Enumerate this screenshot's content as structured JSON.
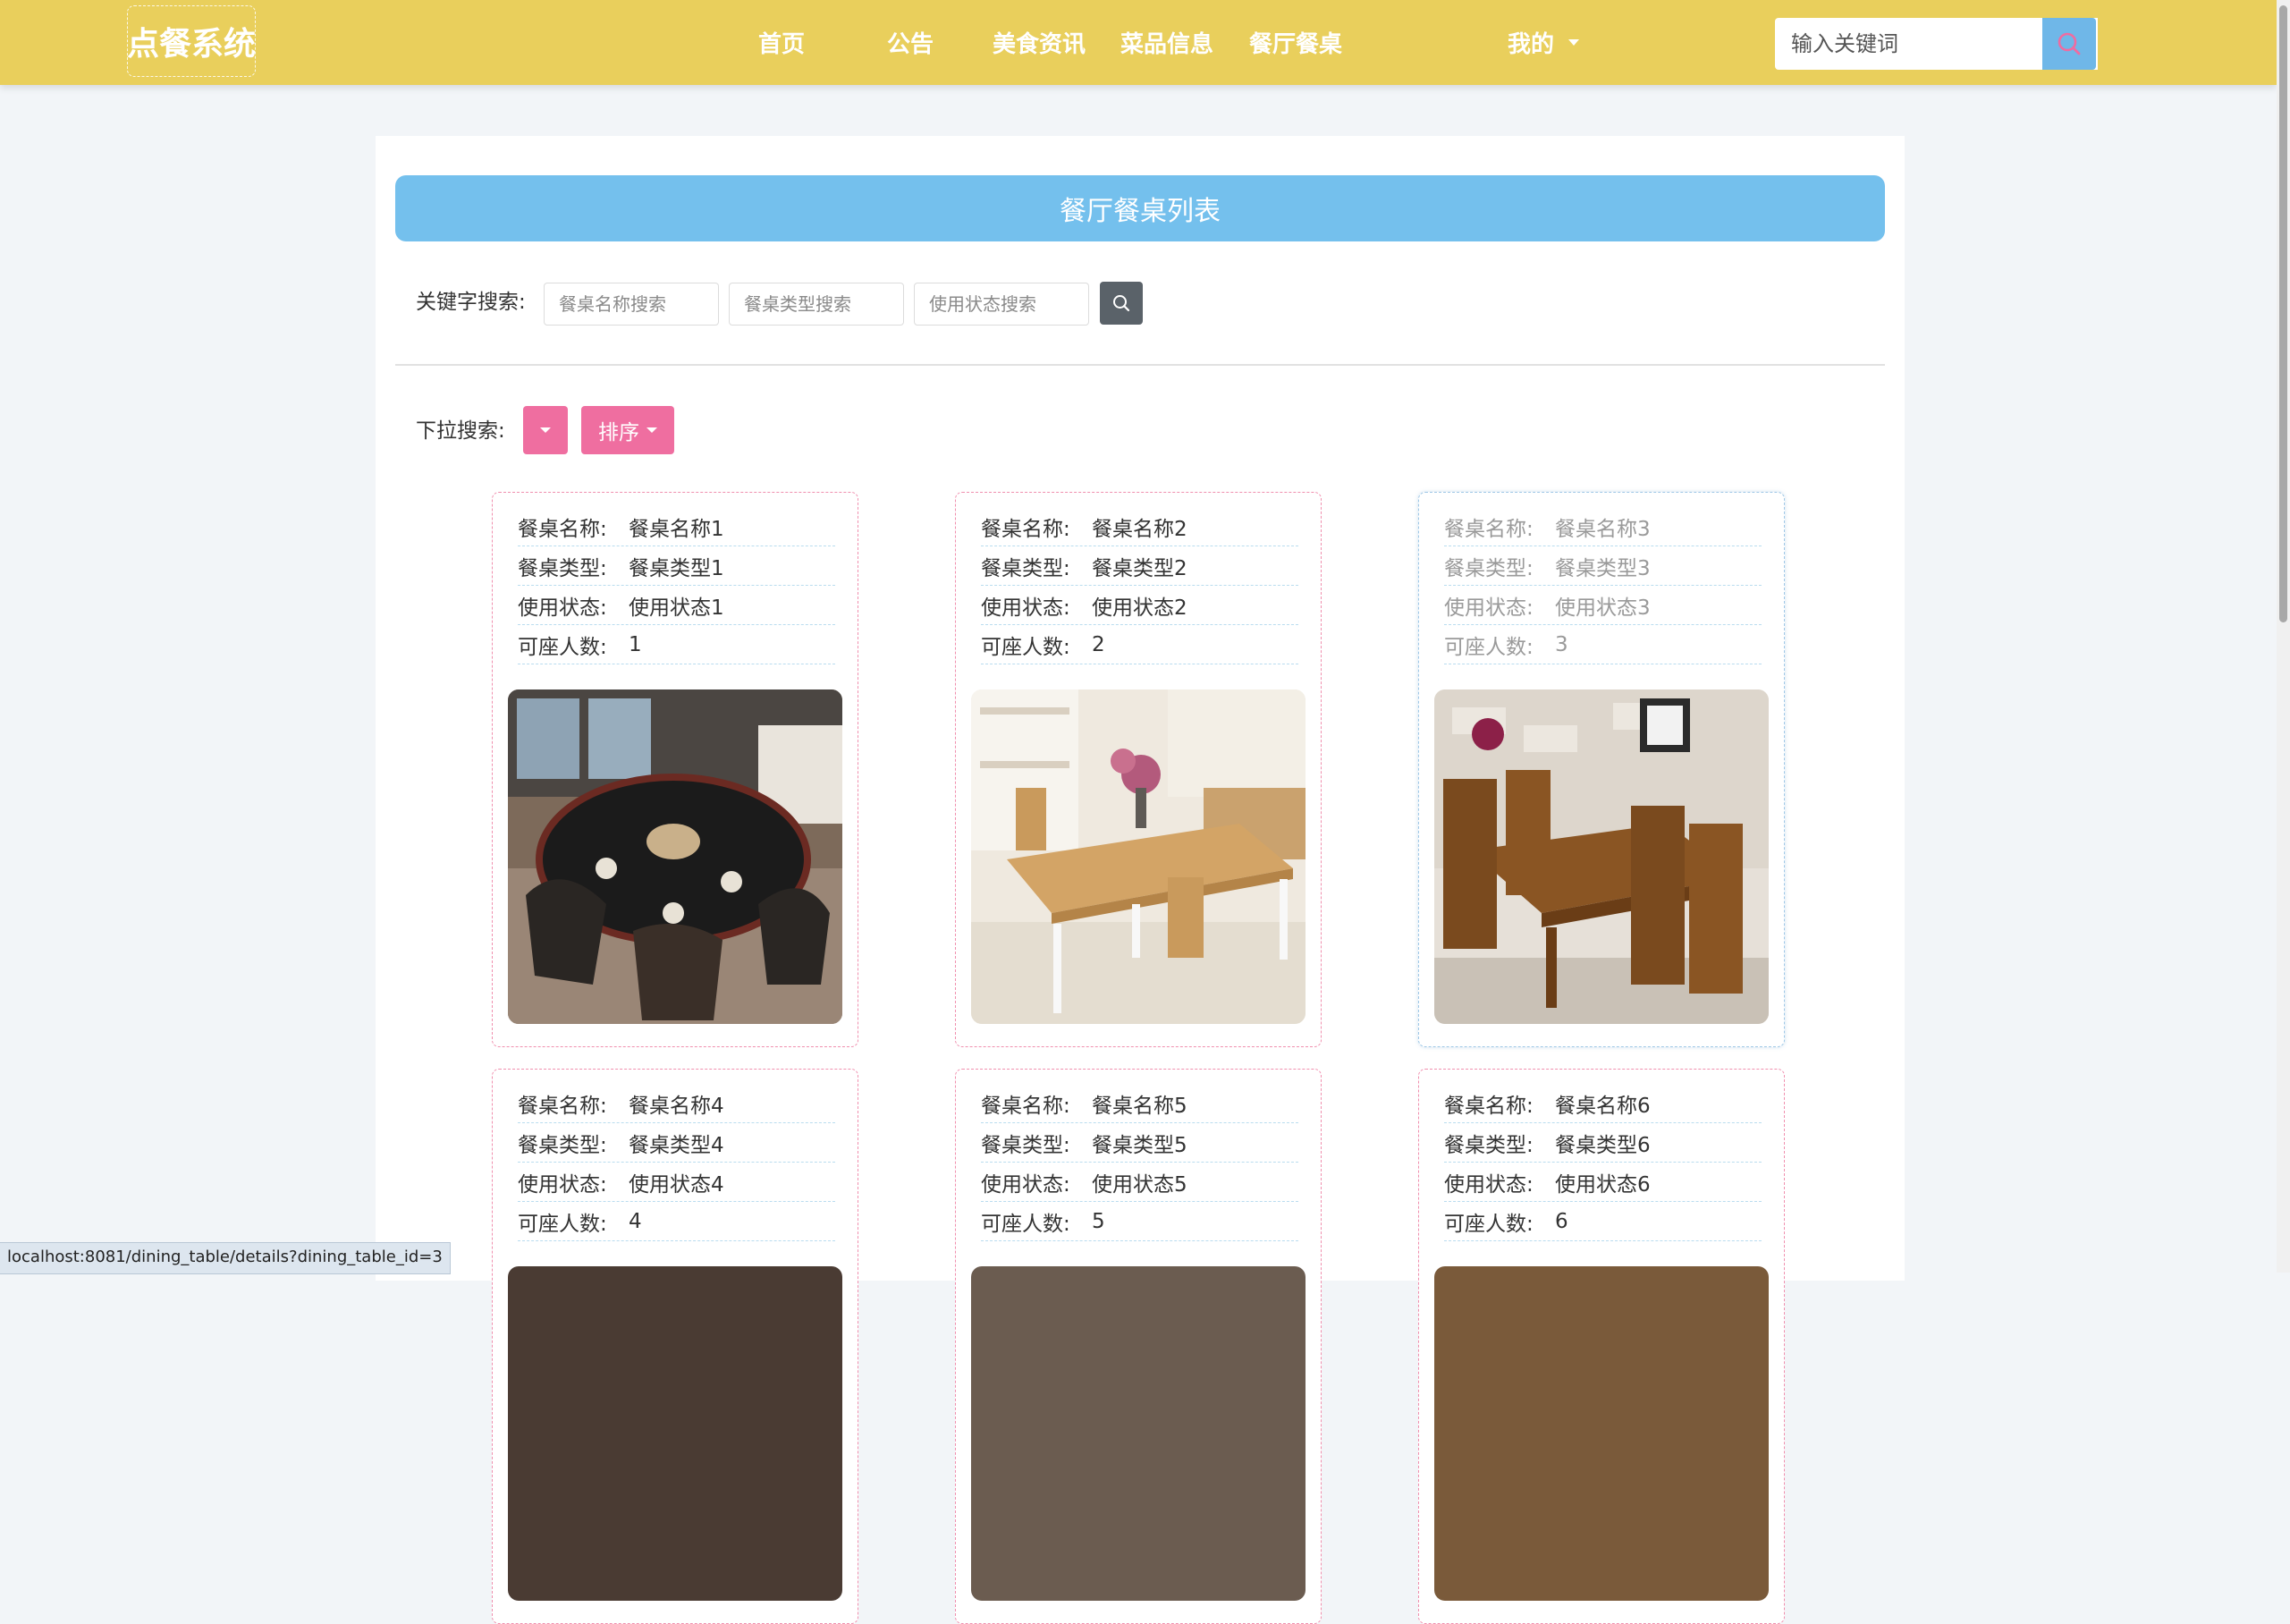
{
  "navbar": {
    "logo": "点餐系统",
    "items": [
      "首页",
      "公告",
      "美食资讯",
      "菜品信息",
      "餐厅餐桌"
    ],
    "user_menu": "我的",
    "search_placeholder": "输入关键词"
  },
  "main": {
    "title": "餐厅餐桌列表",
    "keyword_label": "关键字搜索:",
    "keyword_placeholders": [
      "餐桌名称搜索",
      "餐桌类型搜索",
      "使用状态搜索"
    ],
    "dropdown_label": "下拉搜索:",
    "sort_label": "排序"
  },
  "field_labels": [
    "餐桌名称:",
    "餐桌类型:",
    "使用状态:",
    "可座人数:"
  ],
  "cards": [
    {
      "name": "餐桌名称1",
      "type": "餐桌类型1",
      "status": "使用状态1",
      "seats": "1"
    },
    {
      "name": "餐桌名称2",
      "type": "餐桌类型2",
      "status": "使用状态2",
      "seats": "2"
    },
    {
      "name": "餐桌名称3",
      "type": "餐桌类型3",
      "status": "使用状态3",
      "seats": "3"
    },
    {
      "name": "餐桌名称4",
      "type": "餐桌类型4",
      "status": "使用状态4",
      "seats": "4"
    },
    {
      "name": "餐桌名称5",
      "type": "餐桌类型5",
      "status": "使用状态5",
      "seats": "5"
    },
    {
      "name": "餐桌名称6",
      "type": "餐桌类型6",
      "status": "使用状态6",
      "seats": "6"
    }
  ],
  "statusbar": {
    "url": "localhost:8081/dining_table/details?dining_table_id=3"
  },
  "colors": {
    "navbar": "#e9cf5c",
    "title_bar": "#74c0ed",
    "pink_button": "#ef6ea0"
  }
}
